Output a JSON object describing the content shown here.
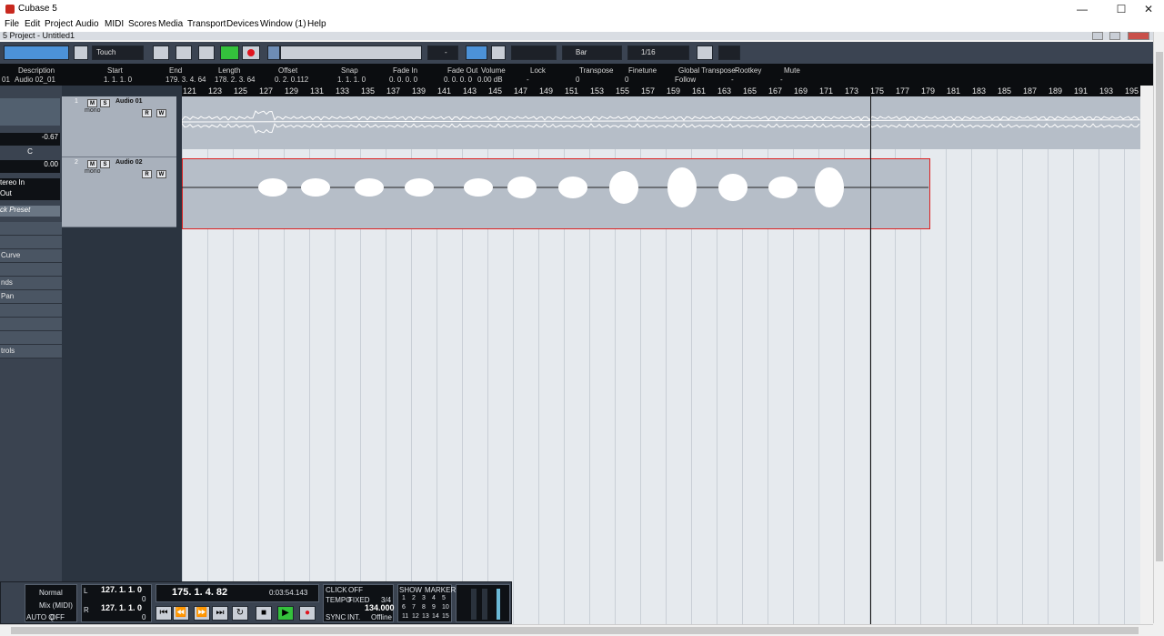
{
  "window": {
    "title": "Cubase 5",
    "controls": {
      "minimize": "—",
      "maximize": "☐",
      "close": "✕"
    }
  },
  "menu": [
    "File",
    "Edit",
    "Project",
    "Audio",
    "MIDI",
    "Scores",
    "Media",
    "Transport",
    "Devices",
    "Window (1)",
    "Help"
  ],
  "project": {
    "title": "5 Project - Untitled1"
  },
  "toolbar": {
    "automation_mode": "Touch",
    "snap_type": "Bar",
    "quantize": "1/16",
    "grid_value": "-"
  },
  "info_line": {
    "headers": [
      "Description",
      "Start",
      "End",
      "Length",
      "Offset",
      "Snap",
      "Fade In",
      "Fade Out",
      "Volume",
      "Lock",
      "Transpose",
      "Finetune",
      "Global Transpose",
      "Rootkey",
      "Mute"
    ],
    "values": [
      "Audio 02_01",
      "1. 1. 1.   0",
      "179. 3. 4. 64",
      "178. 2. 3. 64",
      "0. 2. 0.112",
      "1. 1. 1.   0",
      "0. 0. 0.   0",
      "0. 0. 0.   0",
      "0.00 dB",
      "-",
      "0",
      "0",
      "Follow",
      "-",
      "-"
    ],
    "row_prefix": "01"
  },
  "inspector": {
    "volume": "-0.67",
    "pan": "C",
    "delay": "0.00",
    "input_routing": "tereo In",
    "output_routing": "Out",
    "preset": "ck Preset",
    "sections": [
      "Curve",
      "nds",
      "Pan",
      "trols"
    ]
  },
  "tracks": [
    {
      "number": "1",
      "name": "Audio 01",
      "type": "mono"
    },
    {
      "number": "2",
      "name": "Audio 02",
      "type": "mono"
    }
  ],
  "track_buttons": {
    "mute": "M",
    "solo": "S",
    "read": "R",
    "write": "W"
  },
  "ruler": {
    "bars": [
      "121",
      "123",
      "125",
      "127",
      "129",
      "131",
      "133",
      "135",
      "137",
      "139",
      "141",
      "143",
      "145",
      "147",
      "149",
      "151",
      "153",
      "155",
      "157",
      "159",
      "161",
      "163",
      "165",
      "167",
      "169",
      "171",
      "173",
      "175",
      "177",
      "179",
      "181",
      "183",
      "185",
      "187",
      "189",
      "191",
      "193",
      "195"
    ]
  },
  "transport": {
    "mode": "Normal",
    "mix_mode": "Mix (MIDI)",
    "auto_q": "AUTO Q",
    "auto_q_state": "OFF",
    "left_locator": "127.  1.  1.     0",
    "left_locator_sub": "0",
    "right_locator": "127.  1.  1.     0",
    "right_locator_sub": "0",
    "position": "175.  1.  4.  82",
    "time": "0:03:54.143",
    "click_label": "CLICK",
    "click_state": "OFF",
    "tempo_label": "TEMPO",
    "tempo_mode": "FIXED",
    "signature": "3/4",
    "tempo": "134.000",
    "sync_label": "SYNC",
    "sync_source": "INT.",
    "sync_state": "Offline",
    "show_label": "SHOW",
    "marker_label": "MARKER",
    "markers": [
      "1",
      "2",
      "3",
      "4",
      "5",
      "6",
      "7",
      "8",
      "9",
      "10",
      "11",
      "12",
      "13",
      "14",
      "15"
    ],
    "locator_labels": {
      "left": "L",
      "right": "R"
    }
  },
  "colors": {
    "toolbar_bg": "#3b4452",
    "info_bg": "#0b0d10",
    "track_bg": "#a9b1bc",
    "event_bg": "#b6bec8",
    "play_green": "#34c13c",
    "record_red": "#e0141e",
    "selected_blue": "#4c92d8"
  }
}
